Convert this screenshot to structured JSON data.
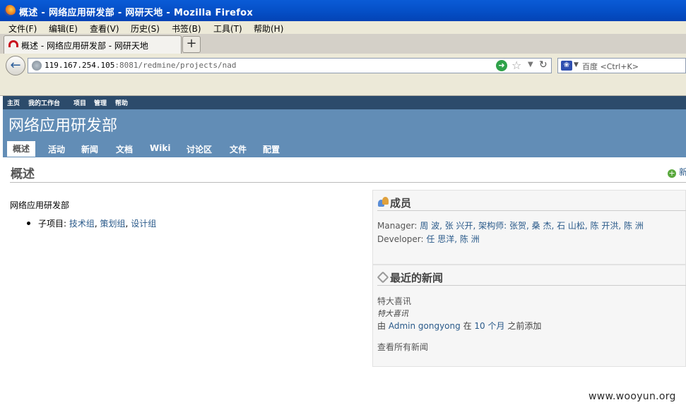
{
  "window": {
    "title": "概述 - 网络应用研发部 - 网研天地 - Mozilla Firefox"
  },
  "menubar": [
    "文件(F)",
    "编辑(E)",
    "查看(V)",
    "历史(S)",
    "书签(B)",
    "工具(T)",
    "帮助(H)"
  ],
  "tab": {
    "label": "概述 - 网络应用研发部 - 网研天地",
    "new_tab": "+"
  },
  "address": {
    "host": "119.167.254.105",
    "rest": ":8081/redmine/projects/nad"
  },
  "search": {
    "placeholder": "百度 <Ctrl+K>"
  },
  "top_menu": [
    "主页",
    "我的工作台",
    "项目",
    "管理",
    "帮助"
  ],
  "project_title": "网络应用研发部",
  "main_menu": [
    "概述",
    "活动",
    "新闻",
    "文档",
    "Wiki",
    "讨论区",
    "文件",
    "配置"
  ],
  "page_heading": "概述",
  "new_subproject": "新",
  "description": "网络应用研发部",
  "subprojects": {
    "label": "子项目:",
    "links": [
      "技术组",
      "策划组",
      "设计组"
    ]
  },
  "members": {
    "title": "成员",
    "manager_label": "Manager:",
    "managers": "周 波, 张 兴开, 架构师: 张贺, 桑 杰, 石 山松, 陈 开洪, 陈 洲",
    "developer_label": "Developer:",
    "developers": "任 思洋, 陈 洲"
  },
  "news": {
    "title": "最近的新闻",
    "item_title": "特大喜讯",
    "item_desc": "特大喜讯",
    "added_by_prefix": "由",
    "author": "Admin gongyong",
    "in": "在",
    "time": "10 个月",
    "added_suffix": "之前添加",
    "view_all": "查看所有新闻"
  },
  "watermark": "www.wooyun.org"
}
